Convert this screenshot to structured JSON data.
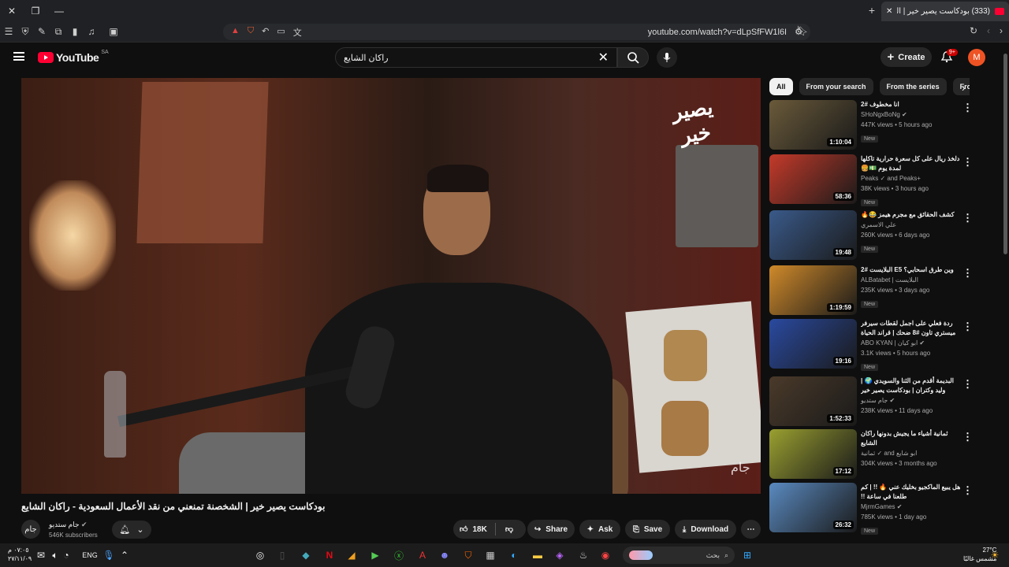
{
  "browser": {
    "tab_title": "(333) بودكاست يصير خير | الشـ",
    "url": "youtube.com/watch?v=dLpSfFW1l6I"
  },
  "youtube": {
    "logo_text": "YouTube",
    "country": "SA",
    "search_query": "راكان الشايع",
    "create_label": "Create",
    "notif_count": "9+",
    "avatar_letter": "M"
  },
  "video": {
    "brand_text": "يصير خير",
    "watermark": "جام",
    "title": "بودكاست يصير خير | الشخصنة تمنعني من نقد الأعمال السعودية - راكان الشايع",
    "channel": "جام ستديو",
    "subscribers": "546K subscribers",
    "likes": "18K",
    "share_label": "Share",
    "ask_label": "Ask",
    "save_label": "Save",
    "download_label": "Download"
  },
  "chips": [
    "All",
    "From your search",
    "From the series",
    "Fro"
  ],
  "recommendations": [
    {
      "title": "انا مخطوف #2",
      "channel": "SHoNgxBoNg",
      "verified": true,
      "stats": "447K views • 5 hours ago",
      "badge": "New",
      "duration": "1:10:04",
      "color": "#6a5a3a"
    },
    {
      "title": "دلخذ ريال على كل سعرة حرارية تاكلها لمدة يوم 💵🍔",
      "channel": "Peaks ✓ and Peaks+",
      "verified": false,
      "stats": "38K views • 3 hours ago",
      "badge": "New",
      "duration": "58:36",
      "color": "#c43a2a"
    },
    {
      "title": "كشف الحقائق مع مجرم هيمز 😂🔥",
      "channel": "علي الاسمري",
      "verified": false,
      "stats": "260K views • 6 days ago",
      "badge": "New",
      "duration": "19:48",
      "color": "#3a5a8a"
    },
    {
      "title": "وين طرق اسحابي؟ E5 البلايست #2",
      "channel": "ALBatabet | البلايست",
      "verified": false,
      "stats": "235K views • 3 days ago",
      "badge": "New",
      "duration": "1:19:59",
      "color": "#d08a2a"
    },
    {
      "title": "ردة فعلي على اجمل لقطات سيرفر ميستري تاون #8 ضحك | قراند الحياة الواقعية",
      "channel": "ABO KYAN | ابو كيان",
      "verified": true,
      "stats": "3.1K views • 5 hours ago",
      "badge": "New",
      "duration": "19:16",
      "color": "#2a4aa0"
    },
    {
      "title": "البديمة أقدم من الثنا والسويدي 🌍 | وليد وكتران | بودكاست يصير خير",
      "channel": "جام ستديو",
      "verified": true,
      "stats": "238K views • 11 days ago",
      "badge": "",
      "duration": "1:52:33",
      "color": "#4a3a2a"
    },
    {
      "title": "ثمانية أشياء ما يجيش بدونها راكان الشايع",
      "channel": "ثمانية ✓ and ابو شايع",
      "verified": false,
      "stats": "304K views • 3 months ago",
      "badge": "",
      "duration": "17:12",
      "color": "#9aa030"
    },
    {
      "title": "هل يبيع الماكجيو بخليك عني 🔥 !! | كم طلعنا في ساعة !!",
      "channel": "MjrmGames",
      "verified": true,
      "stats": "785K views • 1 day ago",
      "badge": "New",
      "duration": "26:32",
      "color": "#5a8ac0"
    }
  ],
  "taskbar": {
    "time": "٠٧:٠٥ م",
    "date": "٢٧/١١/٠٩",
    "lang": "ENG",
    "search_placeholder": "بحث",
    "temp": "27°C",
    "weather": "مشمس غالبًا"
  }
}
